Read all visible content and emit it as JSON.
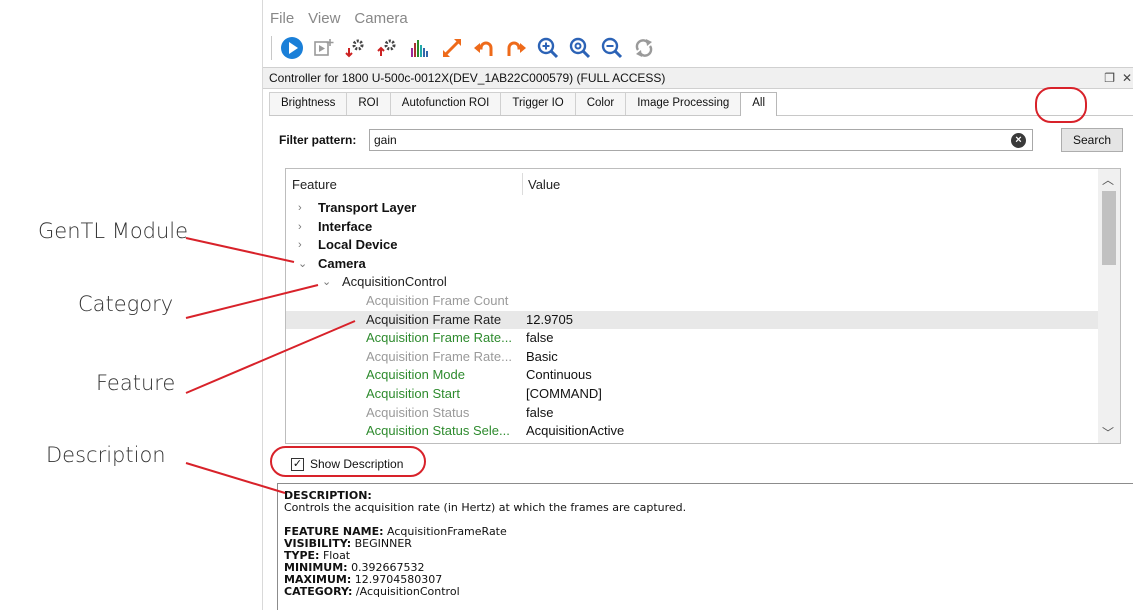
{
  "annotations": {
    "genTL": "GenTL Module",
    "category": "Category",
    "feature": "Feature",
    "description": "Description"
  },
  "menu": [
    "File",
    "View",
    "Camera"
  ],
  "toolbar_icons": [
    "play-icon",
    "add-media-icon",
    "settings-import-icon",
    "settings-export-icon",
    "histogram-icon",
    "fullscreen-icon",
    "rotate-left-icon",
    "rotate-right-icon",
    "zoom-in-icon",
    "zoom-reset-icon",
    "zoom-out-icon",
    "refresh-icon"
  ],
  "title": "Controller for 1800 U-500c-0012X(DEV_1AB22C000579) (FULL ACCESS)",
  "tabs": [
    {
      "label": "Brightness",
      "active": false
    },
    {
      "label": "ROI",
      "active": false
    },
    {
      "label": "Autofunction ROI",
      "active": false
    },
    {
      "label": "Trigger IO",
      "active": false
    },
    {
      "label": "Color",
      "active": false
    },
    {
      "label": "Image Processing",
      "active": false
    },
    {
      "label": "All",
      "active": true
    }
  ],
  "filter": {
    "label": "Filter pattern:",
    "value": "gain",
    "search_label": "Search"
  },
  "tree": {
    "col_feature": "Feature",
    "col_value": "Value",
    "rows": [
      {
        "level": 0,
        "arrow": ">",
        "name": "Transport Layer",
        "value": "",
        "color": "black"
      },
      {
        "level": 0,
        "arrow": ">",
        "name": "Interface",
        "value": "",
        "color": "black"
      },
      {
        "level": 0,
        "arrow": ">",
        "name": "Local Device",
        "value": "",
        "color": "black"
      },
      {
        "level": 0,
        "arrow": "v",
        "name": "Camera",
        "value": "",
        "color": "black"
      },
      {
        "level": 1,
        "arrow": "v",
        "name": "AcquisitionControl",
        "value": "",
        "color": "black"
      },
      {
        "level": 2,
        "arrow": "",
        "name": "Acquisition Frame Count",
        "value": "",
        "color": "gray"
      },
      {
        "level": 2,
        "arrow": "",
        "name": "Acquisition Frame Rate",
        "value": "12.9705",
        "color": "black",
        "selected": true
      },
      {
        "level": 2,
        "arrow": "",
        "name": "Acquisition Frame Rate...",
        "value": "false",
        "color": "green"
      },
      {
        "level": 2,
        "arrow": "",
        "name": "Acquisition Frame Rate...",
        "value": "Basic",
        "color": "gray"
      },
      {
        "level": 2,
        "arrow": "",
        "name": "Acquisition Mode",
        "value": "Continuous",
        "color": "green"
      },
      {
        "level": 2,
        "arrow": "",
        "name": "Acquisition Start",
        "value": "[COMMAND]",
        "color": "green"
      },
      {
        "level": 2,
        "arrow": "",
        "name": "Acquisition Status",
        "value": "false",
        "color": "gray"
      },
      {
        "level": 2,
        "arrow": "",
        "name": "Acquisition Status Sele...",
        "value": "AcquisitionActive",
        "color": "green"
      }
    ]
  },
  "show_description": {
    "label": "Show Description",
    "checked": "✓"
  },
  "description": {
    "heading": "DESCRIPTION:",
    "text": "Controls the acquisition rate (in Hertz) at which the frames are captured.",
    "fields": [
      {
        "key": "FEATURE NAME:",
        "value": "AcquisitionFrameRate"
      },
      {
        "key": "VISIBILITY:",
        "value": "BEGINNER"
      },
      {
        "key": "TYPE:",
        "value": "Float"
      },
      {
        "key": "MINIMUM:",
        "value": "0.392667532"
      },
      {
        "key": "MAXIMUM:",
        "value": "12.9704580307"
      },
      {
        "key": "CATEGORY:",
        "value": "/AcquisitionControl"
      }
    ]
  },
  "colors": {
    "annotation_red": "#d8222a",
    "play_blue": "#1a7fd8",
    "accent_red": "#cc2222",
    "orange": "#ee6a1a",
    "zoom_blue": "#2c63b6",
    "green_text": "#2e8b2e",
    "gray_text": "#9a9a9a"
  }
}
